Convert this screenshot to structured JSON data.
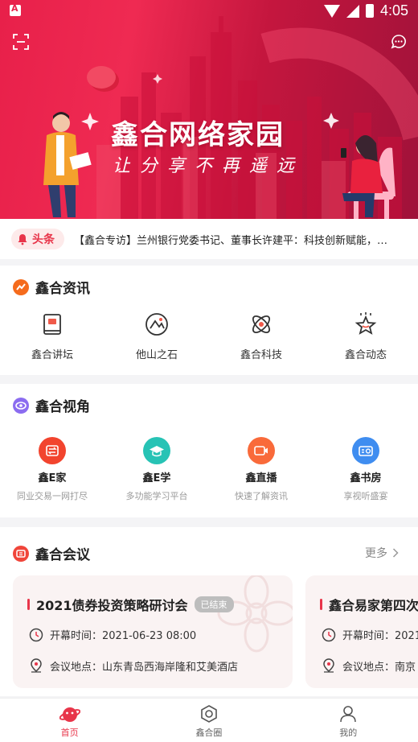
{
  "status_bar": {
    "time": "4:05"
  },
  "banner": {
    "title": "鑫合网络家园",
    "slogan": "让分享不再遥远"
  },
  "headline": {
    "badge": "头条",
    "text": "【鑫合专访】兰州银行党委书记、董事长许建平：科技创新赋能，重…"
  },
  "news": {
    "title": "鑫合资讯",
    "items": [
      {
        "label": "鑫合讲坛",
        "icon": "book-icon"
      },
      {
        "label": "他山之石",
        "icon": "mountain-icon"
      },
      {
        "label": "鑫合科技",
        "icon": "atom-icon"
      },
      {
        "label": "鑫合动态",
        "icon": "star-icon"
      }
    ]
  },
  "view": {
    "title": "鑫合视角",
    "items": [
      {
        "title": "鑫E家",
        "subtitle": "同业交易一网打尽",
        "color": "#f2442e",
        "icon": "exchange-icon"
      },
      {
        "title": "鑫E学",
        "subtitle": "多功能学习平台",
        "color": "#27c3b5",
        "icon": "graduation-cap-icon"
      },
      {
        "title": "鑫直播",
        "subtitle": "快速了解资讯",
        "color": "#f96a3a",
        "icon": "video-icon"
      },
      {
        "title": "鑫书房",
        "subtitle": "享视听盛宴",
        "color": "#3f8df0",
        "icon": "radio-icon"
      }
    ]
  },
  "meeting": {
    "title": "鑫合会议",
    "more": "更多",
    "cards": [
      {
        "name": "2021债券投资策略研讨会",
        "status": "已结束",
        "time_label": "开幕时间：",
        "time": "2021-06-23 08:00",
        "place_label": "会议地点：",
        "place": "山东青岛西海岸隆和艾美酒店"
      },
      {
        "name": "鑫合易家第四次",
        "time_label": "开幕时间：",
        "time": "2021",
        "place_label": "会议地点：",
        "place": "南京"
      }
    ]
  },
  "tabbar": {
    "tabs": [
      {
        "label": "首页",
        "active": true
      },
      {
        "label": "鑫合圈",
        "active": false
      },
      {
        "label": "我的",
        "active": false
      }
    ]
  },
  "colors": {
    "brand": "#e8354a",
    "banner": "#e8204a"
  }
}
